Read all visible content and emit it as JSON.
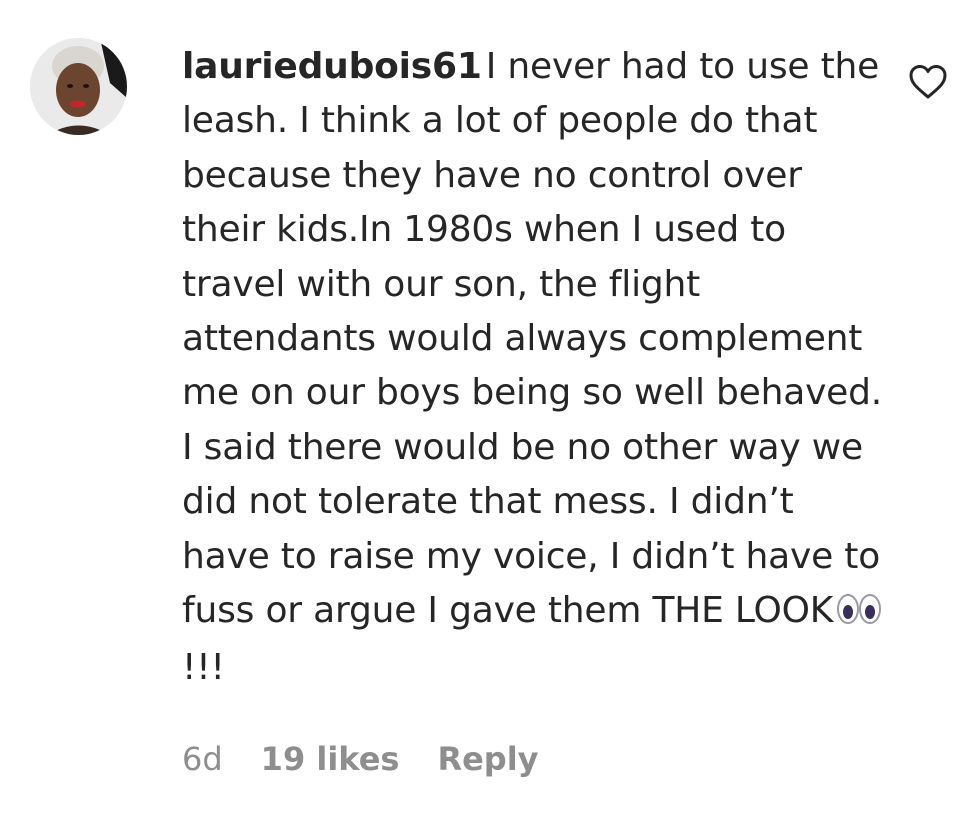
{
  "comment": {
    "username": "lauriedubois61",
    "text_before_emoji": "I never had to use the leash. I think a lot of people do that because they have no control over their kids.In 1980s when I used to travel with our son, the flight attendants would always complement me on our boys being so well behaved. I said there would be no other way we did not tolerate that mess. I didn’t have to raise my voice, I didn’t have to fuss or argue I gave them THE LOOK",
    "emoji_icon": "eyes-emoji",
    "text_after_emoji": "!!!",
    "age": "6d",
    "likes": "19 likes",
    "reply_label": "Reply"
  }
}
